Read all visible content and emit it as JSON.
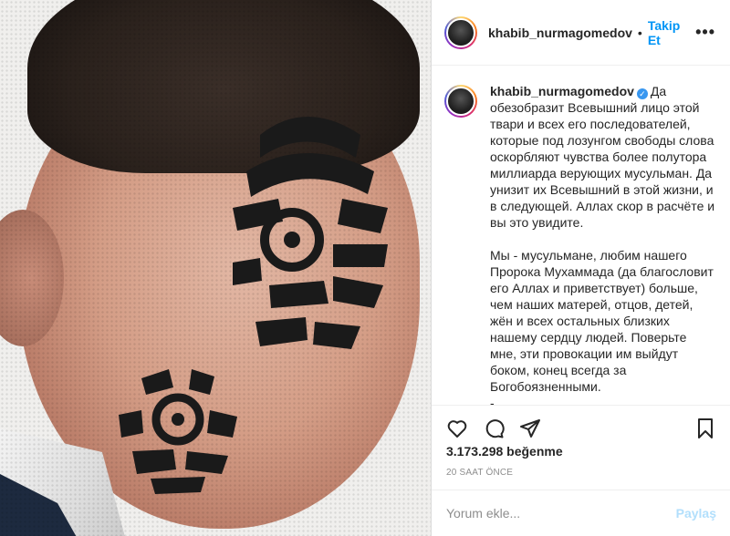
{
  "post": {
    "username": "khabib_nurmagomedov",
    "follow_label": "Takip Et",
    "more_label": "•••",
    "dot": "•",
    "verified_mark": "✓",
    "caption": "Да обезобразит Всевышний лицо этой твари и всех его последователей, которые под лозунгом свободы слова оскорбляют чувства более полутора миллиарда верующих мусульман. Да унизит их Всевышний в этой жизни, и в следующей. Аллах скор в расчёте и вы это увидите.\n\nМы - мусульмане, любим нашего Пророка Мухаммада (да благословит его Аллах и приветствует) больше, чем наших матерей, отцов, детей, жён и всех остальных близких нашему сердцу людей. Поверьте мне, эти провокации им выйдут боком, конец всегда за Богобоязненными.\n-",
    "likes": "3.173.298 beğenme",
    "timestamp": "20 SAAT ÖNCE",
    "comment_placeholder": "Yorum ekle...",
    "post_button": "Paylaş",
    "icons": [
      "heart-icon",
      "comment-icon",
      "share-icon",
      "bookmark-icon"
    ],
    "colors": {
      "accent": "#0095f6",
      "post_disabled": "#b2dffc",
      "muted": "#8e8e8e"
    }
  }
}
